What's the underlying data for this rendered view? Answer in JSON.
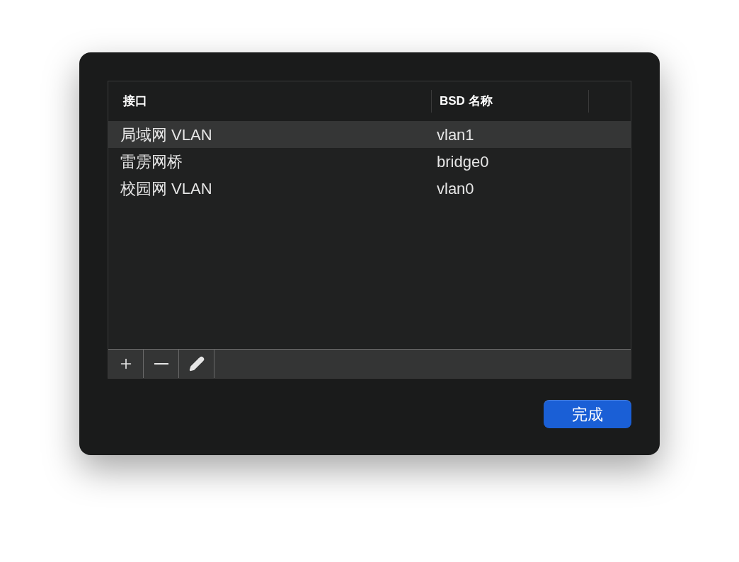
{
  "table": {
    "columns": [
      "接口",
      "BSD 名称"
    ],
    "rows": [
      {
        "cells": [
          "局域网 VLAN",
          "vlan1"
        ],
        "selected": true
      },
      {
        "cells": [
          "雷雳网桥",
          "bridge0"
        ],
        "selected": false
      },
      {
        "cells": [
          "校园网 VLAN",
          "vlan0"
        ],
        "selected": false
      }
    ]
  },
  "toolbar": [
    {
      "kind": "add"
    },
    {
      "kind": "remove"
    },
    {
      "kind": "edit"
    }
  ],
  "done_button": {
    "label": "完成"
  }
}
